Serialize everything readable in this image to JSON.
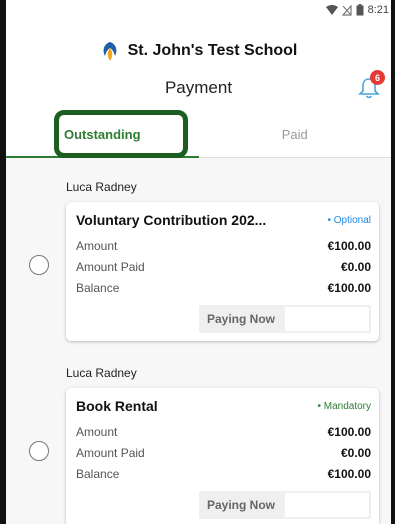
{
  "status_bar": {
    "time": "8:21"
  },
  "header": {
    "school_name": "St. John's Test School",
    "page_title": "Payment",
    "notification_count": "6"
  },
  "tabs": [
    {
      "label": "Outstanding",
      "active": true
    },
    {
      "label": "Paid",
      "active": false
    }
  ],
  "payments": [
    {
      "student": "Luca Radney",
      "title": "Voluntary Contribution 202...",
      "tag": "• Optional",
      "amount_label": "Amount",
      "amount": "€100.00",
      "paid_label": "Amount Paid",
      "paid": "€0.00",
      "balance_label": "Balance",
      "balance": "€100.00",
      "paying_now_label": "Paying Now",
      "paying_now_value": ""
    },
    {
      "student": "Luca Radney",
      "title": "Book Rental",
      "tag": "• Mandatory",
      "amount_label": "Amount",
      "amount": "€100.00",
      "paid_label": "Amount Paid",
      "paid": "€0.00",
      "balance_label": "Balance",
      "balance": "€100.00",
      "paying_now_label": "Paying Now",
      "paying_now_value": ""
    }
  ],
  "colors": {
    "accent": "#2e7d32",
    "highlight_border": "#1b5e20",
    "optional_tag": "#1e88e5",
    "badge": "#e53935"
  }
}
